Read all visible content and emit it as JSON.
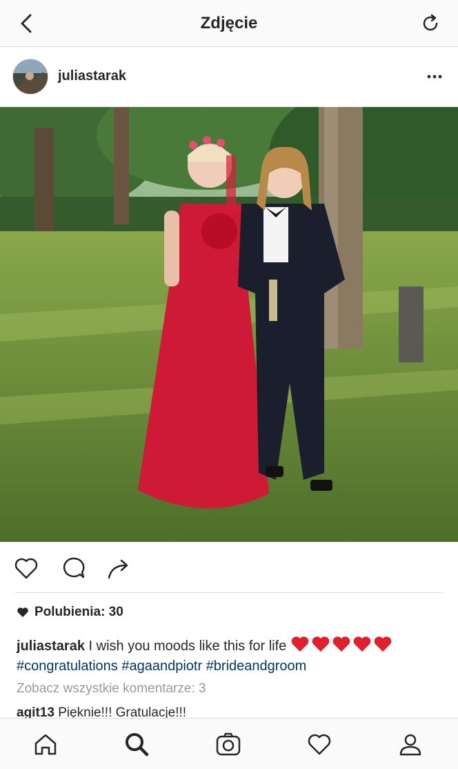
{
  "topbar": {
    "title": "Zdjęcie",
    "back_icon": "chevron-left-icon",
    "refresh_icon": "refresh-icon"
  },
  "post": {
    "username": "juliastarak",
    "more_icon": "more-horizontal-icon",
    "likes_label": "Polubienia: 30",
    "caption_user": "juliastarak",
    "caption_text": " I wish you moods like this for life",
    "caption_hearts": 5,
    "hashtags": [
      "#congratulations",
      "#agaandpiotr",
      "#brideandgroom"
    ],
    "view_all": "Zobacz wszystkie komentarze: 3",
    "comment_user": "agit13",
    "comment_text": " Pięknie!!! Gratulacje!!!"
  },
  "tabbar": {
    "items": [
      "home-icon",
      "search-icon",
      "camera-icon",
      "heart-icon",
      "profile-icon"
    ]
  },
  "colors": {
    "hashtag": "#003569",
    "heart_emoji": "#e0202c",
    "muted": "#999999"
  }
}
